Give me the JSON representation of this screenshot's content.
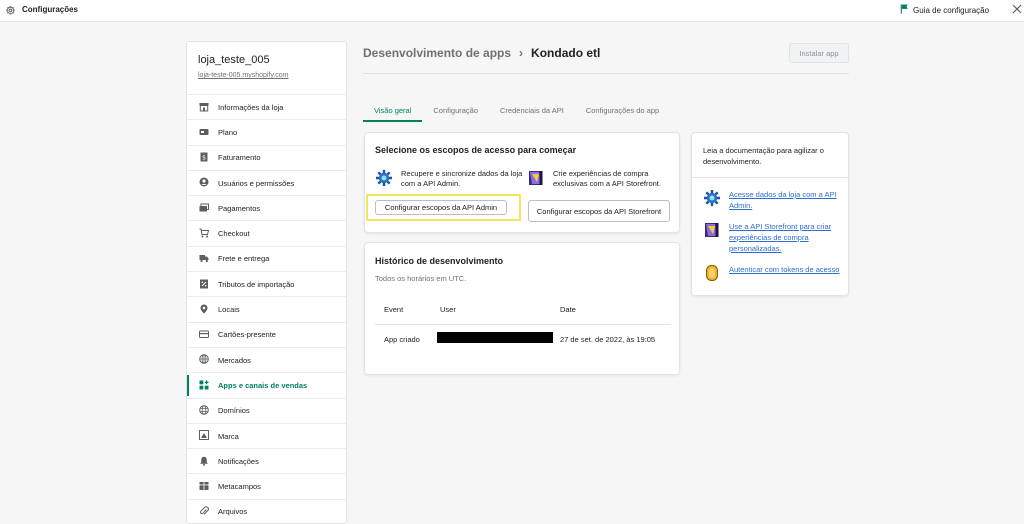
{
  "topbar": {
    "title": "Configurações",
    "guide_label": "Guia de configuração"
  },
  "sidebar": {
    "store_name": "loja_teste_005",
    "store_url": "loja-teste-005.myshopify.com",
    "items": [
      {
        "label": "Informações da loja",
        "icon": "store-icon"
      },
      {
        "label": "Plano",
        "icon": "plan-icon"
      },
      {
        "label": "Faturamento",
        "icon": "billing-icon"
      },
      {
        "label": "Usuários e permissões",
        "icon": "user-icon"
      },
      {
        "label": "Pagamentos",
        "icon": "payments-icon"
      },
      {
        "label": "Checkout",
        "icon": "cart-icon"
      },
      {
        "label": "Frete e entrega",
        "icon": "truck-icon"
      },
      {
        "label": "Tributos de importação",
        "icon": "tax-icon"
      },
      {
        "label": "Locais",
        "icon": "location-icon"
      },
      {
        "label": "Cartões-presente",
        "icon": "gift-card-icon"
      },
      {
        "label": "Mercados",
        "icon": "globe-icon"
      },
      {
        "label": "Apps e canais de vendas",
        "icon": "apps-icon",
        "active": true
      },
      {
        "label": "Domínios",
        "icon": "domain-icon"
      },
      {
        "label": "Marca",
        "icon": "brand-icon"
      },
      {
        "label": "Notificações",
        "icon": "bell-icon"
      },
      {
        "label": "Metacampos",
        "icon": "metafields-icon"
      },
      {
        "label": "Arquivos",
        "icon": "attachment-icon"
      }
    ]
  },
  "header": {
    "breadcrumb_parent": "Desenvolvimento de apps",
    "breadcrumb_separator": "›",
    "app_name": "Kondado etl",
    "install_label": "Instalar app"
  },
  "tabs": [
    {
      "label": "Visão geral",
      "active": true
    },
    {
      "label": "Configuração"
    },
    {
      "label": "Credenciais da API"
    },
    {
      "label": "Configurações do app"
    }
  ],
  "scopes_card": {
    "title": "Selecione os escopos de acesso para começar",
    "admin_text": "Recupere e sincronize dados da loja com a API Admin.",
    "storefront_text": "Crie experiências de compra exclusivas com a API Storefront.",
    "admin_button": "Configurar escopos da API Admin",
    "storefront_button": "Configurar escopos da API Storefront"
  },
  "history_card": {
    "title": "Histórico de desenvolvimento",
    "subtitle": "Todos os horários em UTC.",
    "columns": [
      "Event",
      "User",
      "Date"
    ],
    "rows": [
      {
        "event": "App criado",
        "user": "",
        "date": "27 de set. de 2022, às 19:05"
      }
    ]
  },
  "docs_card": {
    "intro": "Leia a documentação para agilizar o desenvolvimento.",
    "links": [
      {
        "label": "Acesse dados da loja com a API Admin.",
        "icon": "admin-api-icon"
      },
      {
        "label": "Use a API Storefront para criar experiências de compra personalizadas.",
        "icon": "storefront-api-icon"
      },
      {
        "label": "Autenticar com tokens de acesso",
        "icon": "token-icon"
      }
    ]
  },
  "colors": {
    "accent": "#008060",
    "link": "#2c6ecb",
    "highlight": "#f3e65a"
  }
}
